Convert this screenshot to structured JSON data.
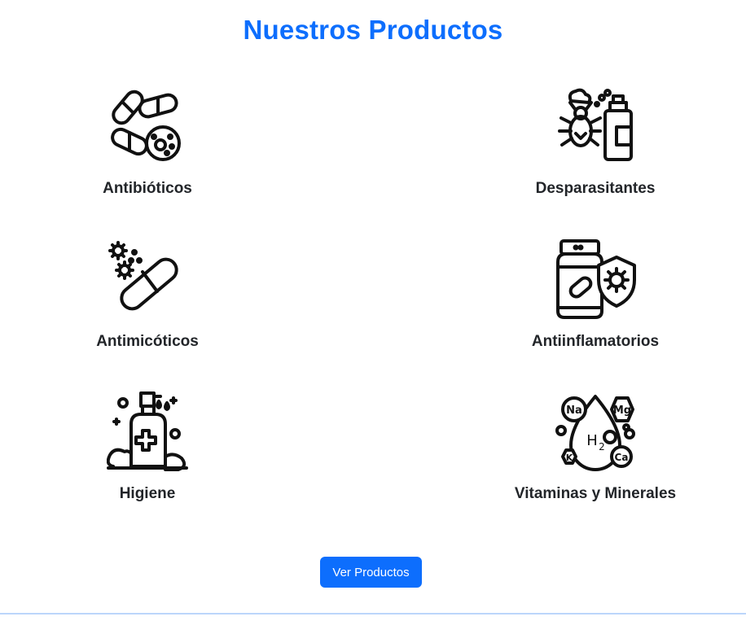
{
  "section_title": "Nuestros Productos",
  "products": [
    {
      "label": "Antibióticos",
      "icon": "pills-bacteria-icon"
    },
    {
      "label": "Desparasitantes",
      "icon": "tick-spray-icon"
    },
    {
      "label": "Antimicóticos",
      "icon": "capsule-fungus-icon"
    },
    {
      "label": "Antiinflamatorios",
      "icon": "pill-bottle-shield-icon"
    },
    {
      "label": "Higiene",
      "icon": "soap-dispenser-icon"
    },
    {
      "label": "Vitaminas y Minerales",
      "icon": "minerals-drop-icon"
    }
  ],
  "cta": {
    "label": "Ver Productos"
  },
  "colors": {
    "accent": "#0d6efd",
    "text": "#222529",
    "divider": "#bcd6fb"
  }
}
